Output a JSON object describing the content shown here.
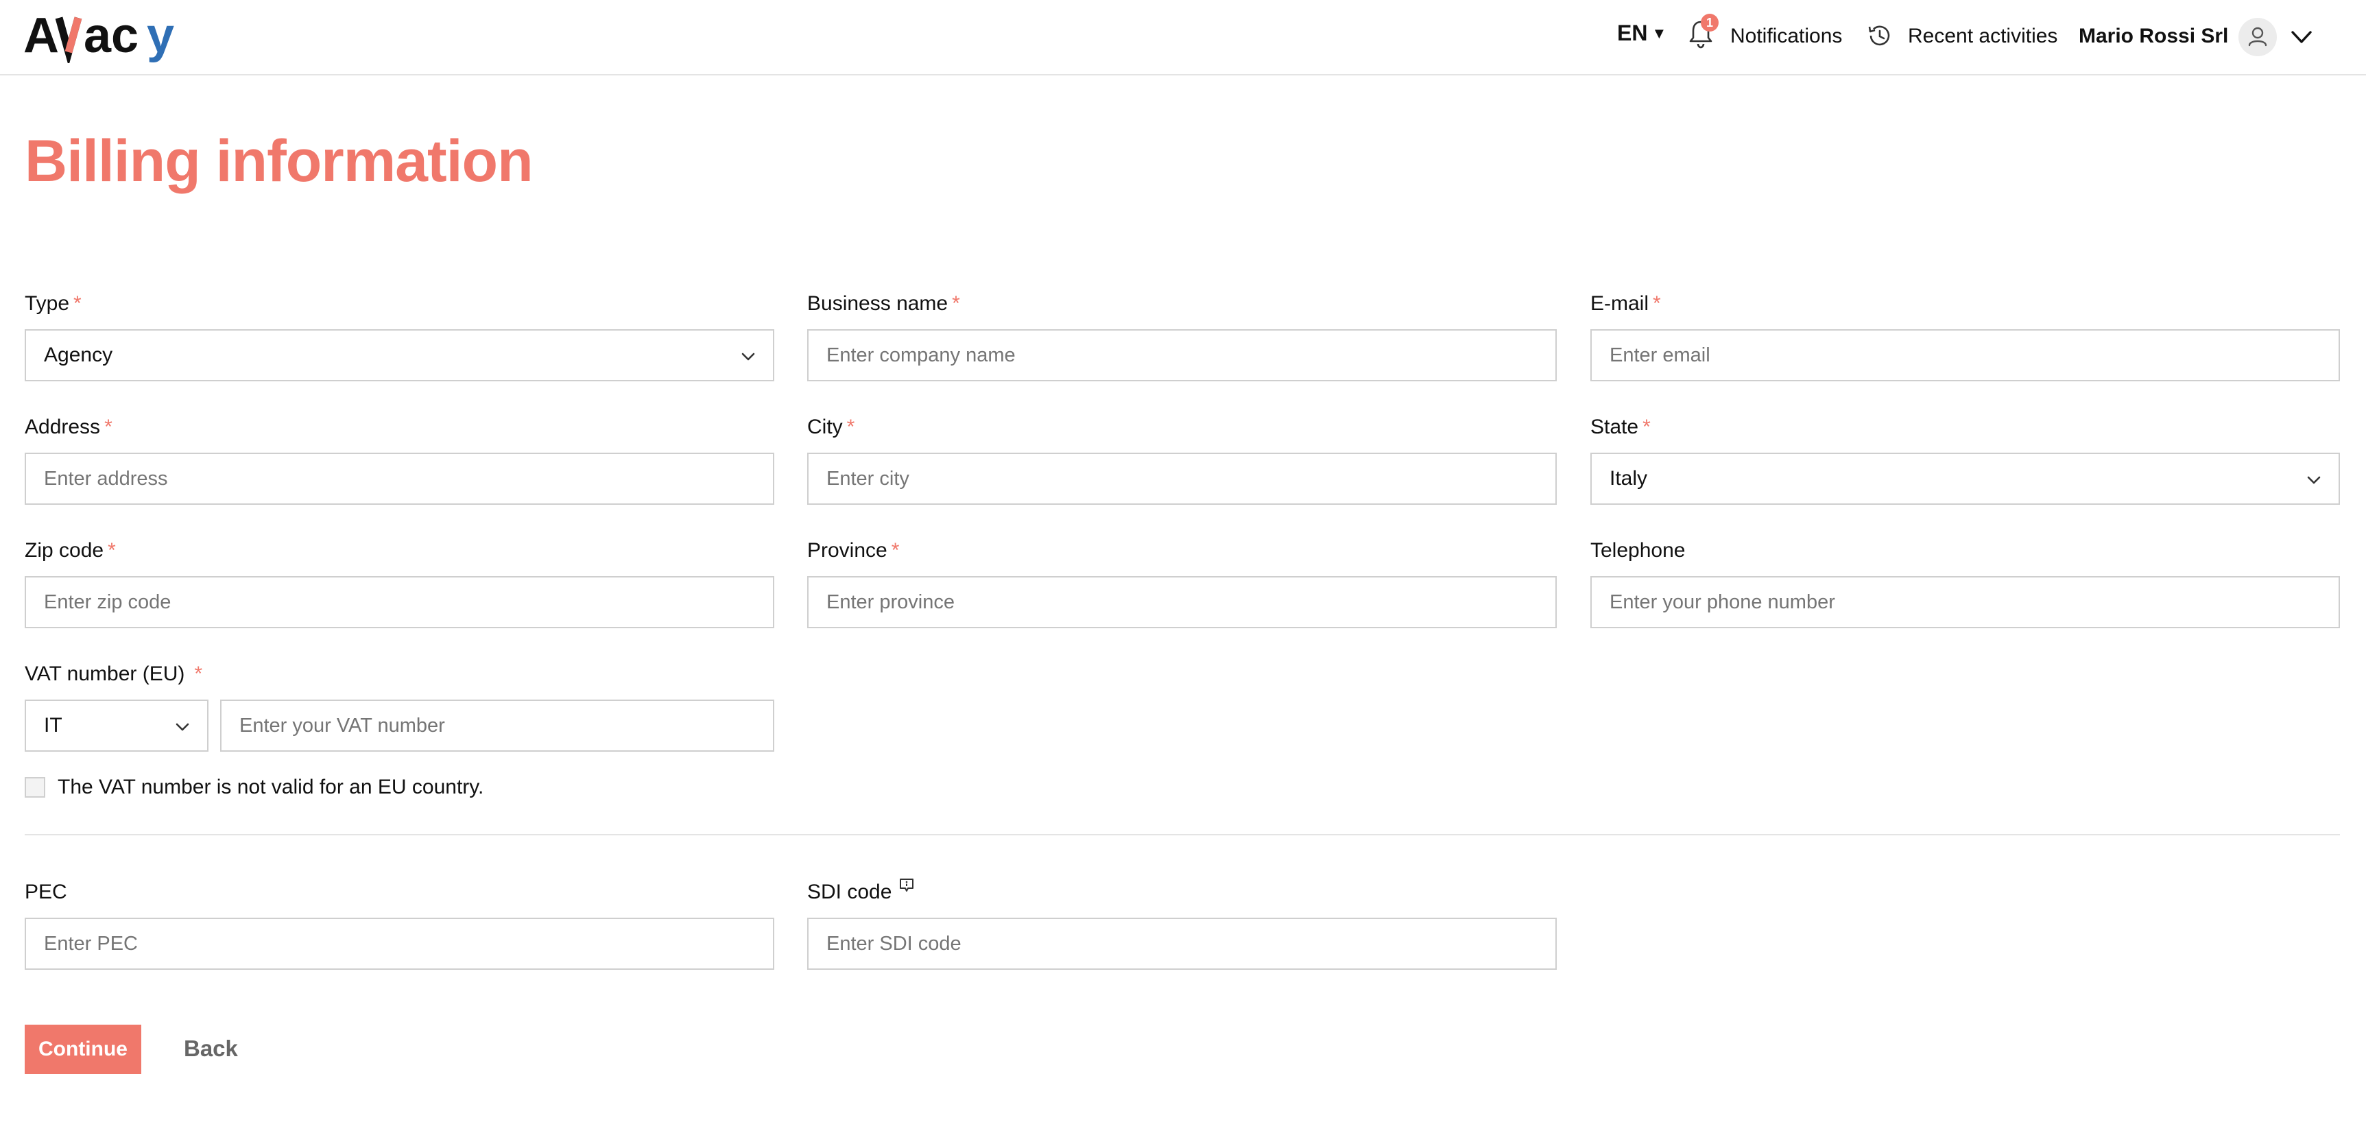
{
  "brand": {
    "logo_text": "AVacy",
    "accent_color": "#f0786b"
  },
  "header": {
    "language": "EN",
    "notifications_label": "Notifications",
    "notifications_count": "1",
    "recent_activities_label": "Recent activities",
    "user_name": "Mario Rossi Srl"
  },
  "page": {
    "title": "Billing information"
  },
  "form": {
    "type": {
      "label": "Type",
      "value": "Agency"
    },
    "business_name": {
      "label": "Business name",
      "placeholder": "Enter company name"
    },
    "email": {
      "label": "E-mail",
      "placeholder": "Enter email"
    },
    "address": {
      "label": "Address",
      "placeholder": "Enter address"
    },
    "city": {
      "label": "City",
      "placeholder": "Enter city"
    },
    "state": {
      "label": "State",
      "value": "Italy"
    },
    "zip": {
      "label": "Zip code",
      "placeholder": "Enter zip code"
    },
    "province": {
      "label": "Province",
      "placeholder": "Enter province"
    },
    "telephone": {
      "label": "Telephone",
      "placeholder": "Enter your phone number"
    },
    "vat": {
      "label": "VAT number (EU)",
      "country": "IT",
      "placeholder": "Enter your VAT number"
    },
    "vat_invalid_checkbox": "The VAT number is not valid for an EU country.",
    "pec": {
      "label": "PEC",
      "placeholder": "Enter PEC"
    },
    "sdi": {
      "label": "SDI code",
      "placeholder": "Enter SDI code"
    },
    "required_mark": "*"
  },
  "actions": {
    "continue_label": "Continue",
    "back_label": "Back"
  }
}
